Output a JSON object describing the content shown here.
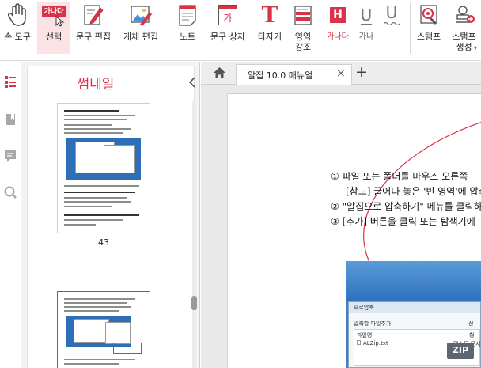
{
  "toolbar": {
    "tools": [
      {
        "label": "손 도구",
        "icon": "hand-icon"
      },
      {
        "label": "선택",
        "icon": "select-text-icon",
        "badge": "가나다"
      },
      {
        "label": "문구 편집",
        "icon": "edit-text-icon"
      },
      {
        "label": "개체 편집",
        "icon": "edit-object-icon"
      },
      {
        "label": "노트",
        "icon": "note-icon"
      },
      {
        "label": "문구 상자",
        "icon": "text-box-icon",
        "glyph": "가"
      },
      {
        "label": "타자기",
        "icon": "typewriter-icon",
        "glyph": "T"
      },
      {
        "label": "영역 강조",
        "icon": "area-highlight-icon"
      },
      {
        "label": "가나다",
        "icon": "highlight-icon",
        "glyph": "H"
      },
      {
        "label": "가나",
        "icon": "underline-icon",
        "glyph": "U"
      },
      {
        "label": "",
        "icon": "wavy-underline-icon",
        "glyph": "U"
      },
      {
        "label": "스탬프",
        "icon": "stamp-icon"
      },
      {
        "label": "스탬프 생성",
        "icon": "stamp-create-icon"
      }
    ],
    "colors": {
      "accent": "#d9334a",
      "active_bg": "#fbe3e5"
    }
  },
  "sidebar": {
    "title": "썸네일",
    "icons": [
      "thumbnail-list-icon",
      "bookmark-icon",
      "comment-icon",
      "search-icon"
    ],
    "pages": [
      {
        "number": "43"
      },
      {
        "number": ""
      }
    ]
  },
  "tabs": {
    "items": [
      {
        "label": "알집 10.0 매뉴얼"
      }
    ],
    "close_glyph": "×",
    "add_glyph": "+"
  },
  "document": {
    "lines": [
      {
        "marker": "①",
        "text": "파일 또는 폴더를 마우스 오른쪽"
      },
      {
        "marker": "",
        "text": "[참고] 끌어다 놓은 '빈 영역'에 압축파"
      },
      {
        "marker": "②",
        "text": "\"알집으로 압축하기\" 메뉴를 클릭하"
      },
      {
        "marker": "③",
        "text": "[추가] 버튼을 클릭 또는 탐색기에"
      }
    ],
    "screenshot": {
      "window_title": "새로압축",
      "section": "압축할 파일추가",
      "column_file": "파일명",
      "column_right": "전",
      "row_file": "ALZip.txt",
      "row_type": "텍스트 문서",
      "row_right": "형"
    },
    "zip_badge": "ZIP"
  }
}
